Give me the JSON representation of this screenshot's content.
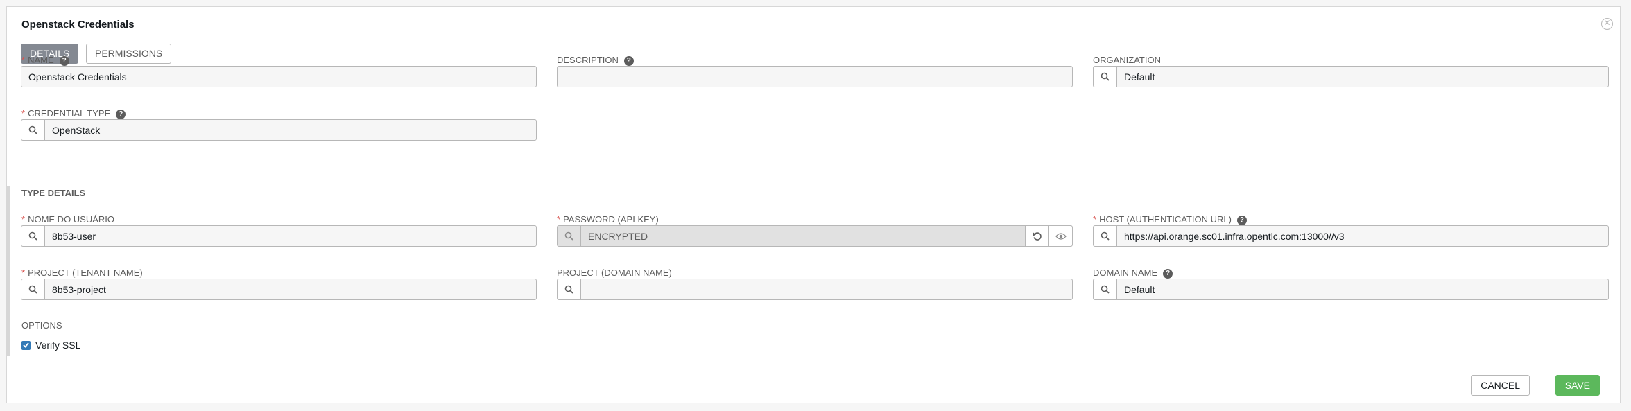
{
  "modal": {
    "title": "Openstack Credentials",
    "close_icon": "close-icon"
  },
  "tabs": [
    {
      "label": "DETAILS",
      "active": true
    },
    {
      "label": "PERMISSIONS",
      "active": false
    }
  ],
  "fields": {
    "name": {
      "label": "NAME",
      "required": true,
      "value": "Openstack Credentials"
    },
    "description": {
      "label": "DESCRIPTION",
      "required": false,
      "value": ""
    },
    "organization": {
      "label": "ORGANIZATION",
      "required": false,
      "value": "Default"
    },
    "credential_type": {
      "label": "CREDENTIAL TYPE",
      "required": true,
      "value": "OpenStack"
    }
  },
  "type_details": {
    "section_label": "TYPE DETAILS",
    "username": {
      "label": "NOME DO USUÁRIO",
      "required": true,
      "value": "8b53-user"
    },
    "password": {
      "label": "PASSWORD (API KEY)",
      "required": true,
      "value": "ENCRYPTED"
    },
    "host": {
      "label": "HOST (AUTHENTICATION URL)",
      "required": true,
      "value": "https://api.orange.sc01.infra.opentlc.com:13000//v3"
    },
    "project": {
      "label": "PROJECT (TENANT NAME)",
      "required": true,
      "value": "8b53-project"
    },
    "project_domain": {
      "label": "PROJECT (DOMAIN NAME)",
      "required": false,
      "value": ""
    },
    "domain_name": {
      "label": "DOMAIN NAME",
      "required": false,
      "value": "Default"
    }
  },
  "options": {
    "section_label": "OPTIONS",
    "verify_ssl": {
      "label": "Verify SSL",
      "checked": true
    }
  },
  "actions": {
    "cancel": "CANCEL",
    "save": "SAVE"
  },
  "colors": {
    "required": "#d9534f",
    "active_tab": "#848992",
    "save": "#5cb85c",
    "checkbox": "#337ab7"
  }
}
